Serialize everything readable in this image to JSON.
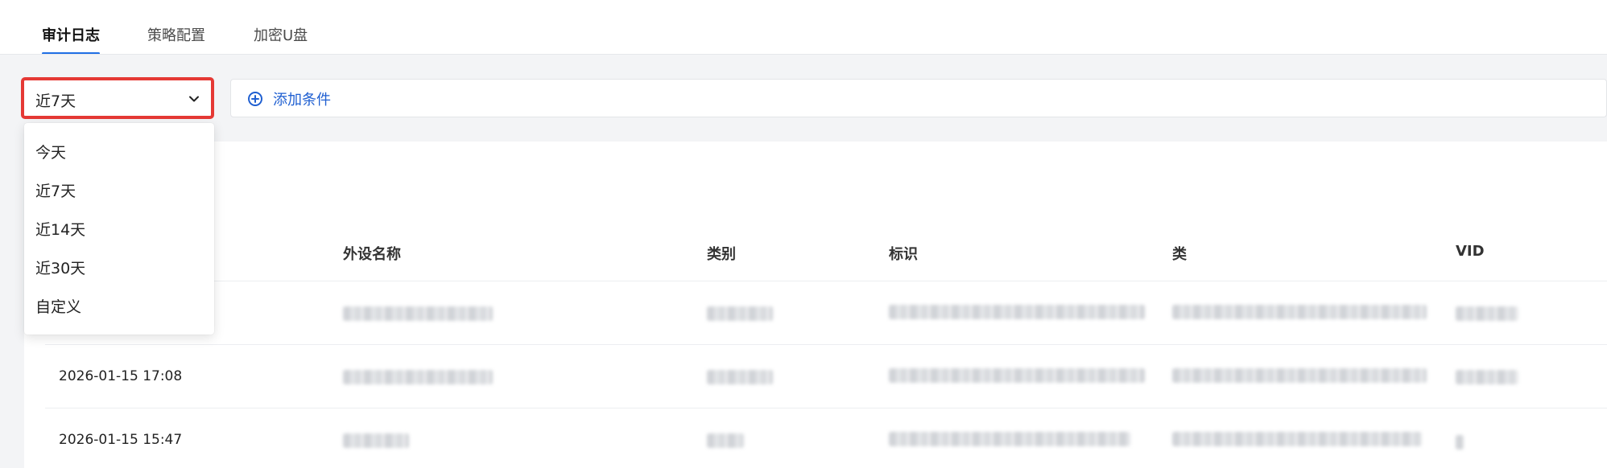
{
  "tabs": [
    {
      "label": "审计日志",
      "active": true
    },
    {
      "label": "策略配置",
      "active": false
    },
    {
      "label": "加密U盘",
      "active": false
    }
  ],
  "filter": {
    "selected": "近7天",
    "options": [
      "今天",
      "近7天",
      "近14天",
      "近30天",
      "自定义"
    ],
    "add_condition": "添加条件"
  },
  "table": {
    "headers": [
      "外设名称",
      "类别",
      "标识",
      "类",
      "VID"
    ],
    "rows": [
      {
        "time": ""
      },
      {
        "time": "2026-01-15 17:08"
      },
      {
        "time": "2026-01-15 15:47"
      }
    ]
  },
  "colors": {
    "accent": "#1f6fe5",
    "highlight": "#e53935",
    "link": "#1f5fd1"
  }
}
